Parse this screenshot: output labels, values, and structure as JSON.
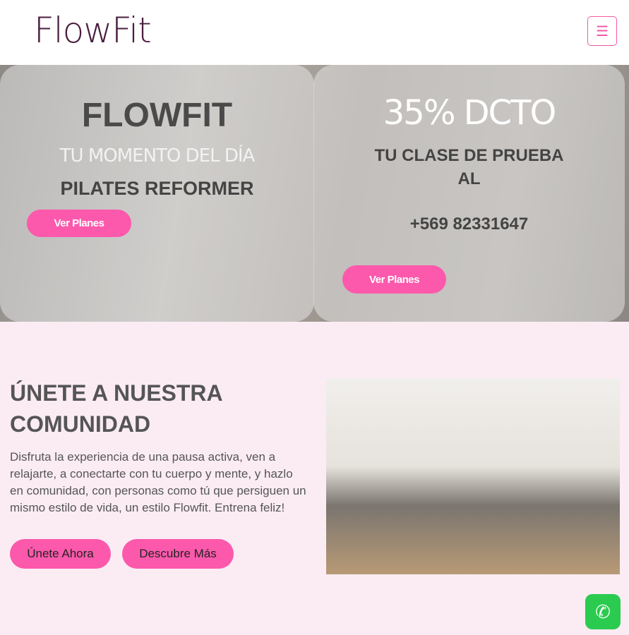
{
  "header": {
    "logo": "FlowFit",
    "menu_icon": "hamburger-icon"
  },
  "hero": {
    "left": {
      "title": "FLOWFIT",
      "tagline": "TU MOMENTO DEL DÍA",
      "subtitle": "PILATES REFORMER",
      "button": "Ver Planes"
    },
    "right": {
      "discount": "35% DCTO",
      "text1": "TU CLASE DE PRUEBA",
      "text2": "AL",
      "phone": "+569 82331647",
      "button": "Ver Planes"
    }
  },
  "community": {
    "title": "ÚNETE A NUESTRA COMUNIDAD",
    "description": "Disfruta la experiencia de una pausa activa, ven a relajarte, a conectarte con tu cuerpo y mente, y hazlo en comunidad, con personas como tú que persiguen un mismo estilo de vida, un estilo Flowfit. Entrena feliz!",
    "join_button": "Únete Ahora",
    "more_button": "Descubre Más"
  },
  "colors": {
    "accent": "#fc59ac",
    "brand": "#4a1c3e"
  }
}
